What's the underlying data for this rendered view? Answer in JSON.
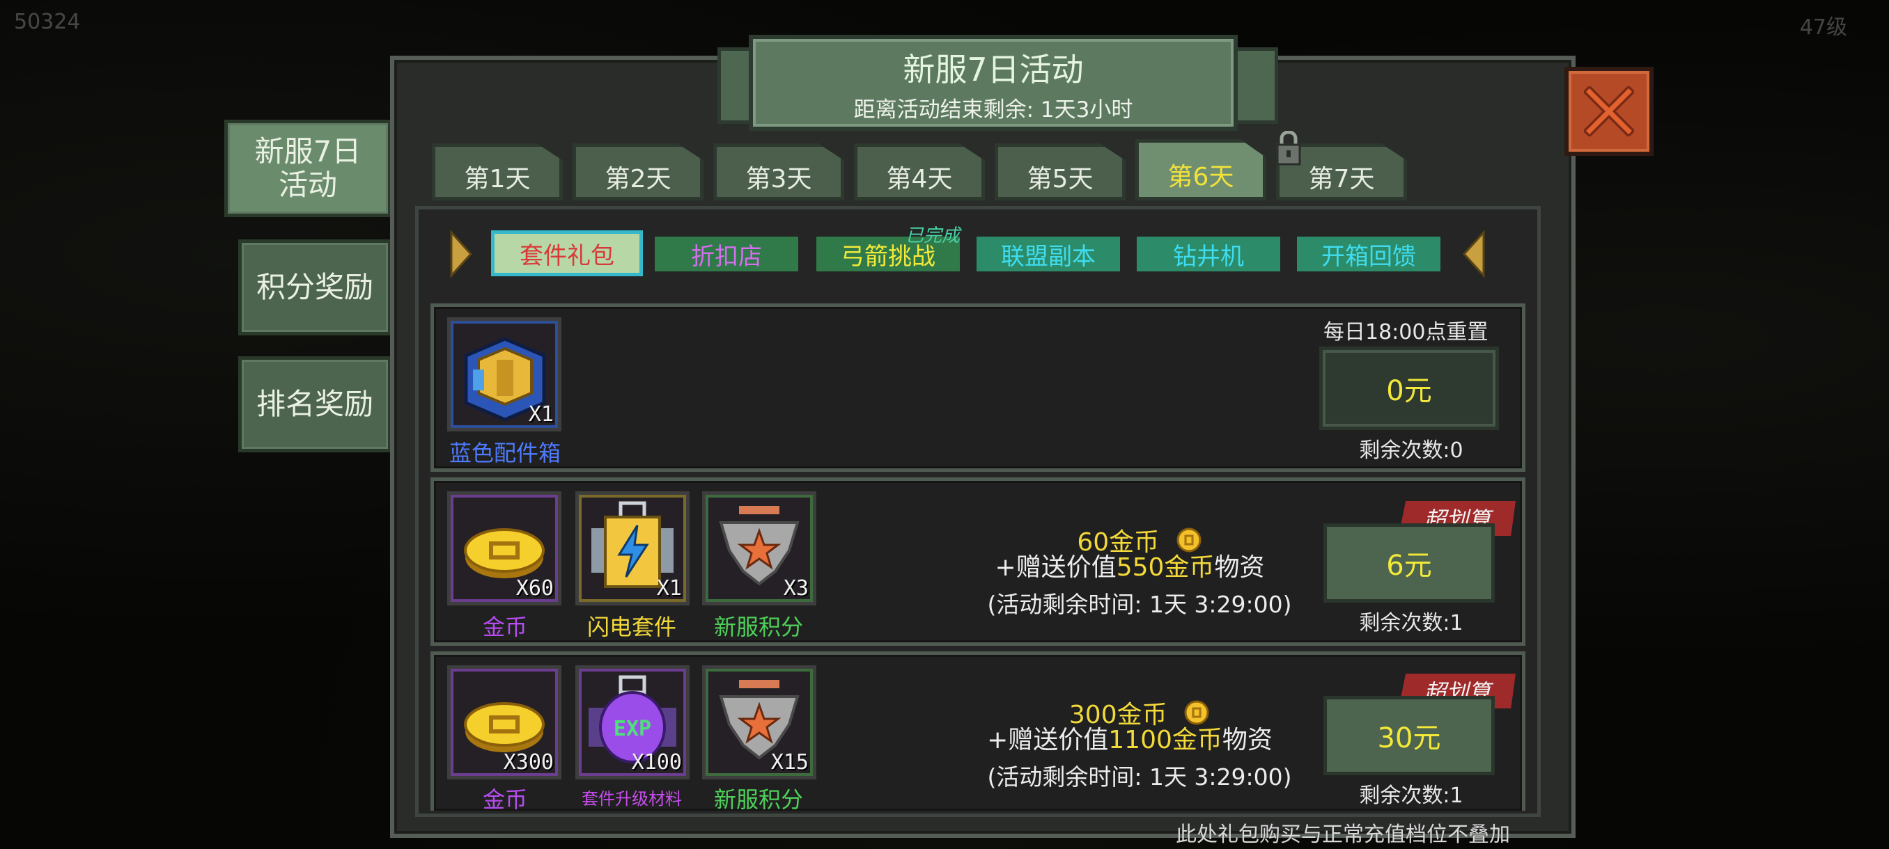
{
  "hud": {
    "left_text": "50324",
    "right_text": "47级"
  },
  "sidebar": {
    "items": [
      {
        "label": "新服7日\n活动",
        "active": true
      },
      {
        "label": "积分奖励",
        "active": false
      },
      {
        "label": "排名奖励",
        "active": false
      }
    ]
  },
  "header": {
    "title": "新服7日活动",
    "subtitle": "距离活动结束剩余: 1天3小时"
  },
  "days": [
    "第1天",
    "第2天",
    "第3天",
    "第4天",
    "第5天",
    "第6天",
    "第7天"
  ],
  "active_day_index": 5,
  "locked_day_index": 6,
  "categories": [
    {
      "label": "套件礼包",
      "selected": true
    },
    {
      "label": "折扣店"
    },
    {
      "label": "弓箭挑战",
      "badge": "已完成"
    },
    {
      "label": "联盟副本"
    },
    {
      "label": "钻井机"
    },
    {
      "label": "开箱回馈"
    }
  ],
  "offers": [
    {
      "items": [
        {
          "name": "蓝色配件箱",
          "qty": "X1",
          "icon": "blue-parts-box-icon",
          "name_color": "#4f7bff"
        }
      ],
      "reset_note": "每日18:00点重置",
      "price": "0元",
      "remaining": "剩余次数:0"
    },
    {
      "items": [
        {
          "name": "金币",
          "qty": "X60",
          "icon": "gold-coin-icon",
          "name_color": "#b64df0"
        },
        {
          "name": "闪电套件",
          "qty": "X1",
          "icon": "lightning-kit-icon",
          "name_color": "#f3d93a"
        },
        {
          "name": "新服积分",
          "qty": "X3",
          "icon": "server-points-emblem-icon",
          "name_color": "#4fd05a"
        }
      ],
      "amount": "60金币",
      "bonus_prefix": "+赠送价值",
      "bonus_value": "550金币",
      "bonus_suffix": "物资",
      "timer": "(活动剩余时间: 1天 3:29:00)",
      "badge": "超划算",
      "price": "6元",
      "remaining": "剩余次数:1"
    },
    {
      "items": [
        {
          "name": "金币",
          "qty": "X300",
          "icon": "gold-coin-icon",
          "name_color": "#b64df0"
        },
        {
          "name": "套件升级材料",
          "qty": "X100",
          "icon": "exp-kit-material-icon",
          "name_color": "#c84df0"
        },
        {
          "name": "新服积分",
          "qty": "X15",
          "icon": "server-points-emblem-icon",
          "name_color": "#4fd05a"
        }
      ],
      "amount": "300金币",
      "bonus_prefix": "+赠送价值",
      "bonus_value": "1100金币",
      "bonus_suffix": "物资",
      "timer": "(活动剩余时间: 1天 3:29:00)",
      "badge": "超划算",
      "price": "30元",
      "remaining": "剩余次数:1"
    }
  ],
  "footnote": "此处礼包购买与正常充值档位不叠加"
}
